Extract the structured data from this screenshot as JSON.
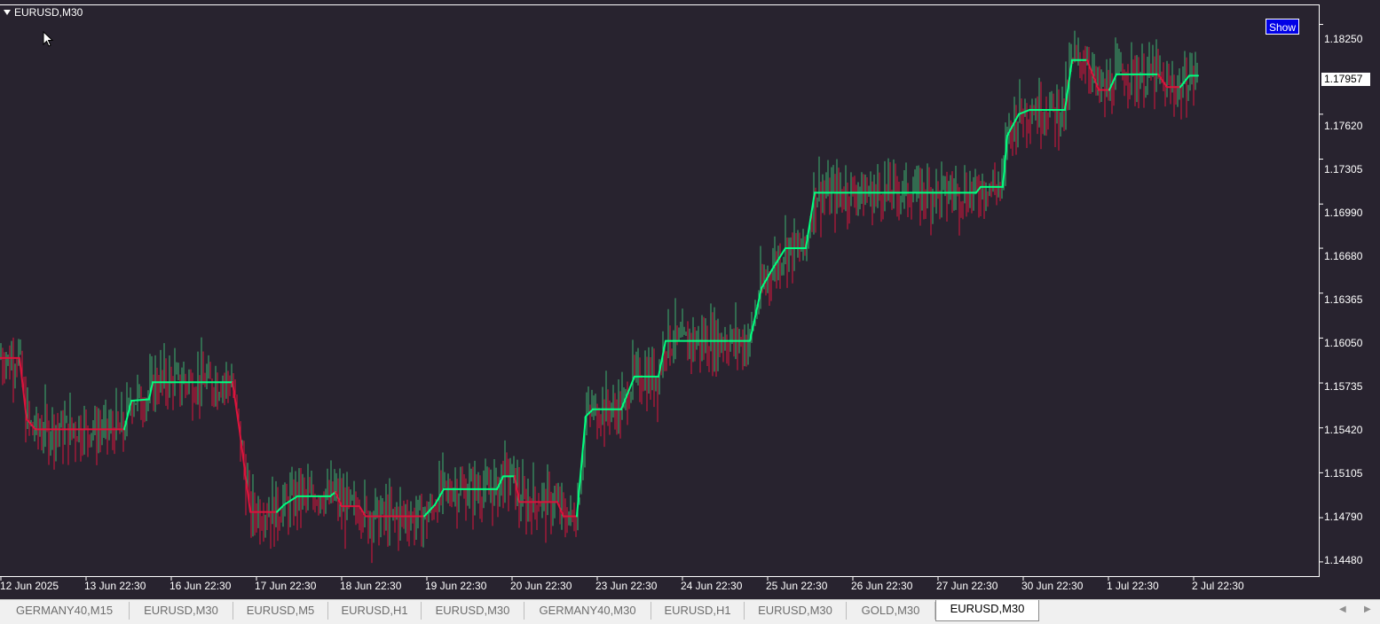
{
  "window": {
    "title": "EURUSD,M30",
    "show_button": "Show",
    "current_price": "1.17957"
  },
  "colors": {
    "background": "#28232f",
    "bull_candle": "#3cb371",
    "bear_candle": "#dc143c",
    "trend_up": "#00ff7f",
    "trend_down": "#dc143c"
  },
  "price_axis": {
    "labels": [
      "1.18250",
      "1.17620",
      "1.17305",
      "1.16990",
      "1.16680",
      "1.16365",
      "1.16050",
      "1.15735",
      "1.15420",
      "1.15105",
      "1.14790",
      "1.14480"
    ]
  },
  "time_axis": {
    "labels": [
      "12 Jun 2025",
      "13 Jun 22:30",
      "16 Jun 22:30",
      "17 Jun 22:30",
      "18 Jun 22:30",
      "19 Jun 22:30",
      "20 Jun 22:30",
      "23 Jun 22:30",
      "24 Jun 22:30",
      "25 Jun 22:30",
      "26 Jun 22:30",
      "27 Jun 22:30",
      "30 Jun 22:30",
      "1 Jul 22:30",
      "2 Jul 22:30"
    ]
  },
  "chart_data": {
    "type": "line",
    "title": "EURUSD,M30",
    "ylim": [
      1.1438,
      1.1839
    ],
    "series": [
      {
        "values": [
          [
            0,
            1.1591
          ],
          [
            22,
            1.1591
          ],
          [
            30,
            1.1548
          ],
          [
            40,
            1.1541
          ],
          [
            140,
            1.1541
          ],
          [
            148,
            1.1561
          ],
          [
            168,
            1.1562
          ],
          [
            172,
            1.1574
          ],
          [
            262,
            1.1574
          ],
          [
            270,
            1.154
          ],
          [
            282,
            1.1483
          ],
          [
            312,
            1.1483
          ],
          [
            320,
            1.1488
          ],
          [
            335,
            1.1494
          ],
          [
            372,
            1.1494
          ],
          [
            378,
            1.1497
          ],
          [
            385,
            1.1487
          ],
          [
            405,
            1.1487
          ],
          [
            412,
            1.148
          ],
          [
            478,
            1.148
          ],
          [
            490,
            1.1488
          ],
          [
            500,
            1.1499
          ],
          [
            560,
            1.1499
          ],
          [
            567,
            1.1508
          ],
          [
            580,
            1.1508
          ],
          [
            585,
            1.149
          ],
          [
            628,
            1.149
          ],
          [
            635,
            1.148
          ],
          [
            650,
            1.148
          ],
          [
            660,
            1.155
          ],
          [
            668,
            1.1555
          ],
          [
            700,
            1.1555
          ],
          [
            715,
            1.1578
          ],
          [
            742,
            1.1578
          ],
          [
            750,
            1.1603
          ],
          [
            845,
            1.1603
          ],
          [
            858,
            1.164
          ],
          [
            870,
            1.1653
          ],
          [
            885,
            1.1668
          ],
          [
            908,
            1.1668
          ],
          [
            918,
            1.1707
          ],
          [
            1100,
            1.1707
          ],
          [
            1105,
            1.1711
          ],
          [
            1130,
            1.1711
          ],
          [
            1135,
            1.1747
          ],
          [
            1148,
            1.1762
          ],
          [
            1160,
            1.1765
          ],
          [
            1200,
            1.1765
          ],
          [
            1208,
            1.18
          ],
          [
            1225,
            1.18
          ],
          [
            1238,
            1.1779
          ],
          [
            1250,
            1.1779
          ],
          [
            1258,
            1.179
          ],
          [
            1305,
            1.179
          ],
          [
            1315,
            1.1781
          ],
          [
            1330,
            1.1781
          ],
          [
            1340,
            1.1789
          ],
          [
            1350,
            1.1789
          ]
        ]
      }
    ]
  },
  "tabs": [
    {
      "label": "GERMANY40,M15"
    },
    {
      "label": "EURUSD,M30"
    },
    {
      "label": "EURUSD,M5"
    },
    {
      "label": "EURUSD,H1"
    },
    {
      "label": "EURUSD,M30"
    },
    {
      "label": "GERMANY40,M30"
    },
    {
      "label": "EURUSD,H1"
    },
    {
      "label": "EURUSD,M30"
    },
    {
      "label": "GOLD,M30"
    },
    {
      "label": "EURUSD,M30"
    }
  ],
  "active_tab_index": 9
}
